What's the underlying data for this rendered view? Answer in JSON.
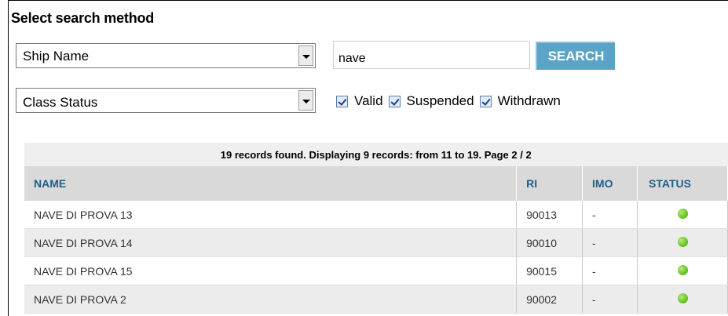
{
  "title": "Select search method",
  "search_field": {
    "selected": "Ship Name"
  },
  "search_input": {
    "value": "nave"
  },
  "search_button": {
    "label": "SEARCH"
  },
  "status_filter": {
    "selected": "Class Status"
  },
  "checkboxes": [
    {
      "label": "Valid",
      "checked": true
    },
    {
      "label": "Suspended",
      "checked": true
    },
    {
      "label": "Withdrawn",
      "checked": true
    }
  ],
  "results": {
    "info": "19 records found. Displaying 9 records: from 11 to 19. Page 2 / 2",
    "columns": [
      "NAME",
      "RI",
      "IMO",
      "STATUS"
    ],
    "rows": [
      {
        "name": "NAVE DI PROVA 13",
        "ri": "90013",
        "imo": "-",
        "status": "green"
      },
      {
        "name": "NAVE DI PROVA 14",
        "ri": "90010",
        "imo": "-",
        "status": "green"
      },
      {
        "name": "NAVE DI PROVA 15",
        "ri": "90015",
        "imo": "-",
        "status": "green"
      },
      {
        "name": "NAVE DI PROVA 2",
        "ri": "90002",
        "imo": "-",
        "status": "green"
      }
    ]
  },
  "colors": {
    "header_text": "#1d5f87",
    "button": "#5ba3c7",
    "status_ok": "#6fc72a"
  }
}
